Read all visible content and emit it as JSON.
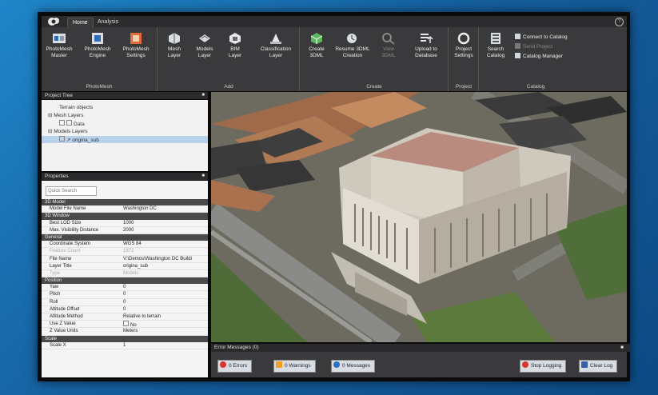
{
  "ribbon": {
    "tabs": [
      "Home",
      "Analysis"
    ],
    "groups": {
      "photomesh": {
        "title": "PhotoMesh",
        "buttons": [
          "PhotoMesh\nMaster",
          "PhotoMesh\nEngine",
          "PhotoMesh\nSettings"
        ]
      },
      "add": {
        "title": "Add",
        "buttons": [
          "Mesh\nLayer",
          "Models\nLayer",
          "BIM\nLayer",
          "Classification\nLayer"
        ]
      },
      "create": {
        "title": "Create",
        "buttons": [
          "Create\n3DML",
          "Resume 3DML\nCreation",
          "View\n3DML",
          "Upload to\nDatabase"
        ]
      },
      "project": {
        "title": "Project",
        "buttons": [
          "Project\nSettings"
        ]
      },
      "catalog": {
        "title": "Catalog",
        "buttons": [
          "Search\nCatalog"
        ],
        "small": [
          "Connect to Catalog",
          "Send Project",
          "Catalog Manager"
        ]
      }
    }
  },
  "project_tree": {
    "title": "Project Tree",
    "nodes": [
      "Terrain objects",
      "Mesh Layers",
      "Data",
      "Models Layers",
      "origina_sub"
    ]
  },
  "properties": {
    "title": "Properties",
    "search_placeholder": "Quick Search",
    "sections": [
      {
        "name": "3D Model",
        "rows": [
          [
            "Model File Name",
            "Washington DC"
          ]
        ]
      },
      {
        "name": "3D Window",
        "rows": [
          [
            "Best LOD Size",
            "1000"
          ],
          [
            "Max. Visibility Distance",
            "2000"
          ]
        ]
      },
      {
        "name": "General",
        "rows": [
          [
            "Coordinate System",
            "WGS 84"
          ],
          [
            "Feature Count",
            "1872"
          ],
          [
            "File Name",
            "V:\\Demos\\Washington DC Buildi"
          ],
          [
            "Layer Title",
            "origina_sub"
          ],
          [
            "Type",
            "Models"
          ]
        ]
      },
      {
        "name": "Position",
        "rows": [
          [
            "Yaw",
            "0"
          ],
          [
            "Pitch",
            "0"
          ],
          [
            "Roll",
            "0"
          ],
          [
            "Altitude Offset",
            "0"
          ],
          [
            "Altitude Method",
            "Relative to terrain"
          ],
          [
            "Use Z Value",
            "No"
          ],
          [
            "Z Value Units",
            "Meters"
          ]
        ]
      },
      {
        "name": "Scale",
        "rows": [
          [
            "Scale X",
            "1"
          ]
        ]
      }
    ]
  },
  "messages": {
    "title": "Error Messages (0)",
    "errors": "0 Errors",
    "warnings": "0 Warnings",
    "info": "0 Messages",
    "stop_logging": "Stop Logging",
    "clear_log": "Clear Log"
  },
  "colors": {
    "ribbon_bg": "#3a3a3c",
    "desktop_bg": "#1a6fb0",
    "selection": "#b9d2ec"
  }
}
